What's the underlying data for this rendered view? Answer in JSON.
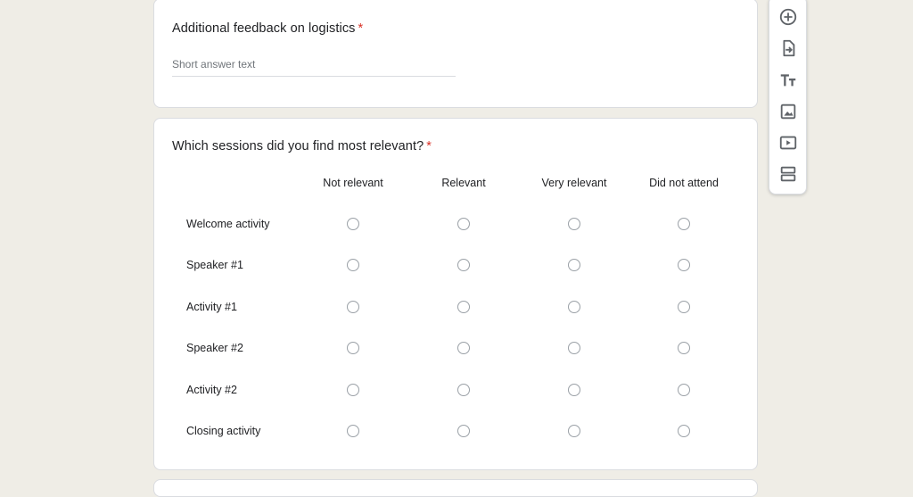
{
  "question1": {
    "title": "Additional feedback on logistics",
    "required_mark": "*",
    "placeholder": "Short answer text"
  },
  "question2": {
    "title": "Which sessions did you find most relevant?",
    "required_mark": "*",
    "columns": [
      "Not relevant",
      "Relevant",
      "Very relevant",
      "Did not attend"
    ],
    "rows": [
      "Welcome activity",
      "Speaker #1",
      "Activity #1",
      "Speaker #2",
      "Activity #2",
      "Closing activity"
    ]
  },
  "toolbar": {
    "tools": [
      "add-question-icon",
      "import-questions-icon",
      "add-title-icon",
      "add-image-icon",
      "add-video-icon",
      "add-section-icon"
    ]
  },
  "colors": {
    "background": "#efede6",
    "card": "#ffffff",
    "required": "#d93025",
    "icon": "#5f6368"
  }
}
